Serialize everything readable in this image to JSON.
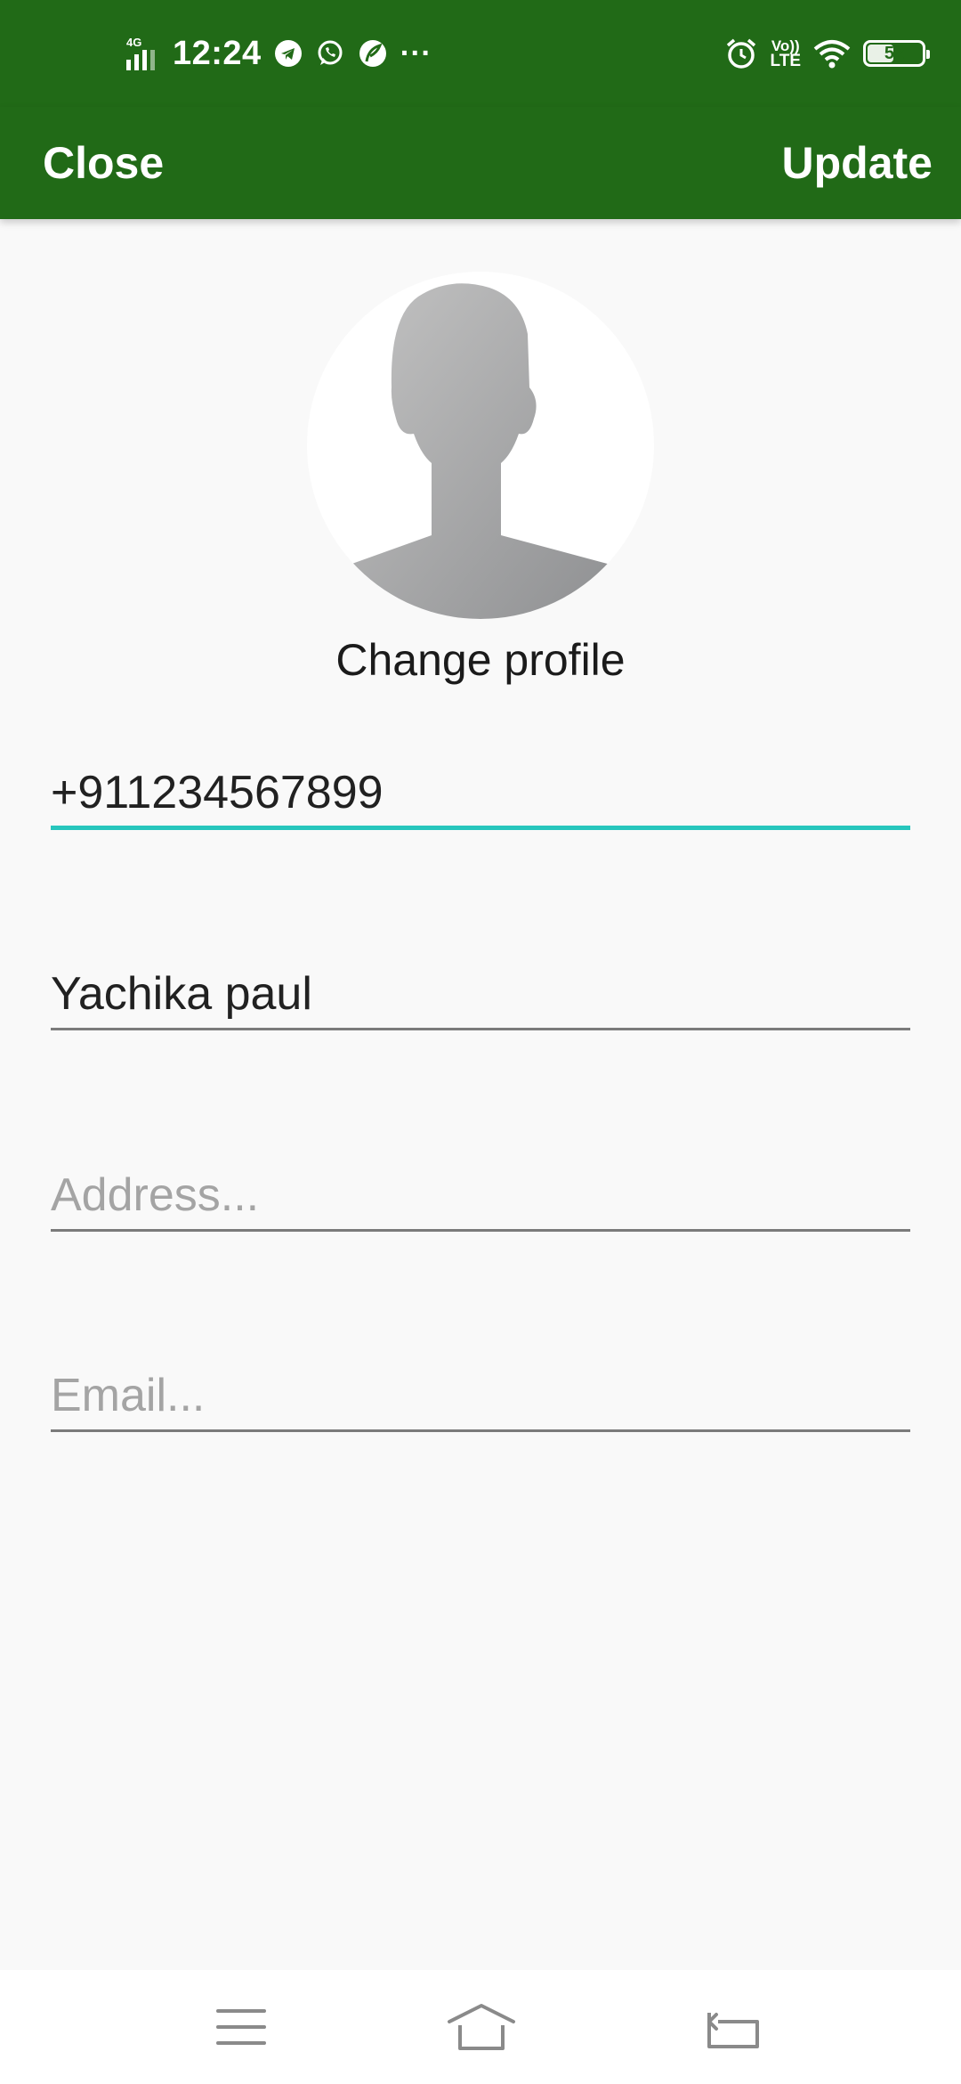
{
  "status_bar": {
    "network": "4G",
    "time": "12:24",
    "overflow": "···",
    "volte_top": "Vo))",
    "volte_bottom": "LTE",
    "battery": "52",
    "battery_level": 0.52,
    "icons": [
      "telegram-icon",
      "whatsapp-icon",
      "leaf-icon",
      "alarm-icon",
      "wifi-icon",
      "battery-icon"
    ]
  },
  "app_bar": {
    "close_label": "Close",
    "update_label": "Update",
    "color": "#216a17"
  },
  "profile": {
    "change_label": "Change profile"
  },
  "form": {
    "phone_value": "+911234567899",
    "name_value": "Yachika paul",
    "address_value": "",
    "address_placeholder": "Address...",
    "email_value": "",
    "email_placeholder": "Email...",
    "active_color": "#27c6bd"
  },
  "nav": {
    "icons": [
      "menu-icon",
      "home-icon",
      "back-icon"
    ]
  }
}
